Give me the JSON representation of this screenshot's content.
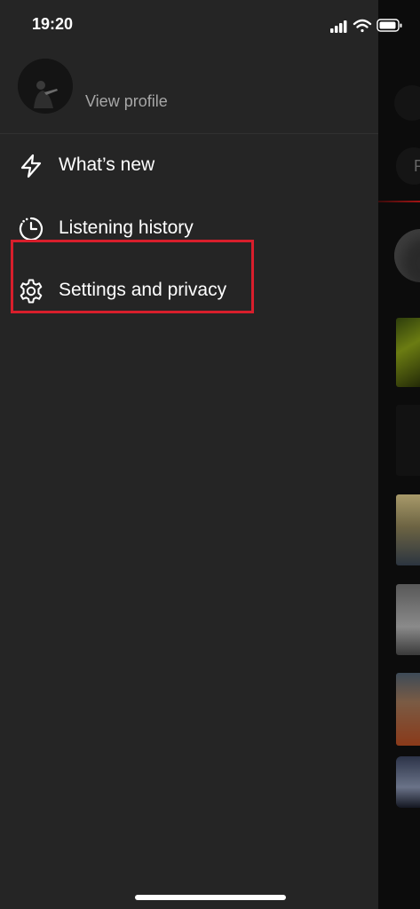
{
  "status_bar": {
    "time": "19:20",
    "icons": [
      "signal-icon",
      "wifi-icon",
      "battery-icon"
    ]
  },
  "drawer": {
    "profile": {
      "view_profile_label": "View profile"
    },
    "menu": [
      {
        "label": "What’s new",
        "icon": "lightning-icon"
      },
      {
        "label": "Listening history",
        "icon": "history-clock-icon"
      },
      {
        "label": "Settings and privacy",
        "icon": "gear-icon"
      }
    ]
  },
  "background_app": {
    "chip_label": "P"
  },
  "colors": {
    "drawer_background": "#252525",
    "highlight_border": "#d81e2c",
    "primary_text": "#ffffff",
    "secondary_text": "#a7a7a7"
  }
}
